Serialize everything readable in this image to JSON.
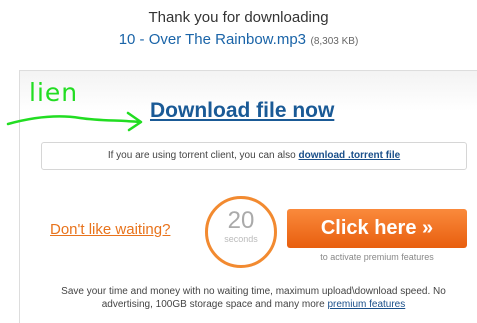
{
  "header": {
    "thanks_text": "Thank you for downloading",
    "file_name": "10 - Over The Rainbow.mp3",
    "file_size": "(8,303 KB)"
  },
  "annotation": {
    "text": "lien",
    "color": "#22dd22"
  },
  "download": {
    "link_text": "Download file now",
    "color": "#1a5a96"
  },
  "torrent": {
    "prefix": "If you are using torrent client, you can also ",
    "link_text": "download .torrent file"
  },
  "wait": {
    "dont_like_text": "Don't like waiting?",
    "countdown": "20",
    "countdown_unit": "seconds",
    "button_label": "Click here »",
    "button_caption": "to activate premium features",
    "accent_color": "#f28a30"
  },
  "footer": {
    "line1": "Save your time and money with no waiting time, maximum upload\\download speed. No",
    "line2_prefix": "advertising, 100GB storage space and many more ",
    "premium_link": "premium features"
  }
}
